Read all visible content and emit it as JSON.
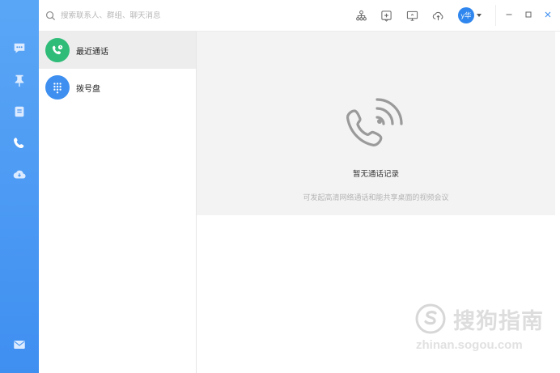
{
  "search": {
    "placeholder": "搜索联系人、群组、聊天消息"
  },
  "toolbar": {
    "items": [
      {
        "icon": "org-chart-icon"
      },
      {
        "icon": "add-box-icon"
      },
      {
        "icon": "screen-share-icon"
      },
      {
        "icon": "cloud-upload-icon"
      }
    ]
  },
  "user": {
    "avatar_text": "y华"
  },
  "sidebar": {
    "items": [
      {
        "icon": "chat-bubble-icon"
      },
      {
        "icon": "pin-icon"
      },
      {
        "icon": "document-icon"
      },
      {
        "icon": "phone-icon",
        "active": true
      },
      {
        "icon": "cloud-icon"
      }
    ],
    "bottom": {
      "icon": "mail-icon"
    }
  },
  "call_menu": {
    "items": [
      {
        "label": "最近通话",
        "icon": "recent-call-icon",
        "color": "#2ebc78",
        "active": true
      },
      {
        "label": "拨号盘",
        "icon": "dialpad-icon",
        "color": "#3e8ff0",
        "active": false
      }
    ]
  },
  "empty_state": {
    "icon": "phone-ringing-icon",
    "title": "暂无通话记录",
    "subtitle": "可发起高清网络通话和能共享桌面的视频会议"
  },
  "watermark": {
    "text": "搜狗指南",
    "url": "zhinan.sogou.com"
  },
  "colors": {
    "rail_top": "#5aa6f6",
    "rail_bottom": "#3f8ff1",
    "accent": "#2f86ee",
    "green": "#2ebc78"
  }
}
